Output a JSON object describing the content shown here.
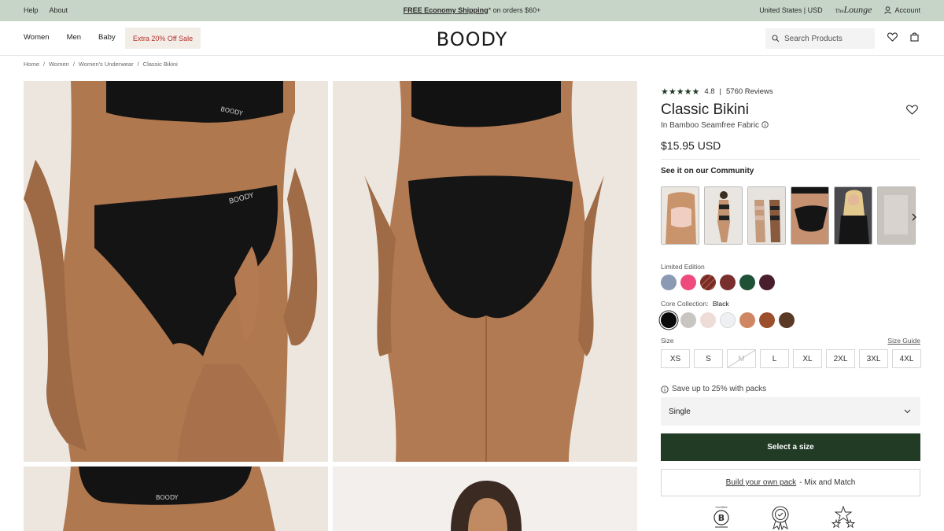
{
  "topbar": {
    "help": "Help",
    "about": "About",
    "promo_bold": "FREE Economy Shipping",
    "promo_rest": "* on orders $60+",
    "region": "United States | USD",
    "lounge_prefix": "The",
    "lounge": "Lounge",
    "account": "Account"
  },
  "header": {
    "nav": [
      "Women",
      "Men",
      "Baby"
    ],
    "sale": "Extra 20% Off Sale",
    "logo": "BOODY",
    "search_placeholder": "Search Products"
  },
  "breadcrumb": [
    "Home",
    "Women",
    "Women's Underwear",
    "Classic Bikini"
  ],
  "product": {
    "stars": "★★★★★",
    "rating": "4.8",
    "separator": "|",
    "reviews": "5760 Reviews",
    "title": "Classic Bikini",
    "fabric": "In Bamboo Seamfree Fabric",
    "price": "$15.95 USD",
    "community": "See it on our Community",
    "limited_label": "Limited Edition",
    "core_label": "Core Collection:",
    "core_selected": "Black",
    "size_label": "Size",
    "size_guide": "Size Guide",
    "sizes": [
      "XS",
      "S",
      "M",
      "L",
      "XL",
      "2XL",
      "3XL",
      "4XL"
    ],
    "unavailable_size": "M",
    "save_text": "Save up to 25% with packs",
    "pack_selected": "Single",
    "cta": "Select a size",
    "build_link": "Build your own pack",
    "build_rest": "- Mix and Match",
    "image_logo": "BOODY"
  },
  "colors": {
    "accent": "#213b25",
    "topbar": "#c7d5c8",
    "sale_text": "#b5302a",
    "limited": [
      "#8a9ab5",
      "#ef4a7e",
      "#7a2a24",
      "#7a2f2f",
      "#1f5136",
      "#4a1d2c"
    ],
    "core": [
      "#0a0a0a",
      "#c9c6c2",
      "#efdcd6",
      "#eef0f4",
      "#cf8662",
      "#9c4f2c",
      "#5a3a26"
    ]
  },
  "icons": [
    "user-icon",
    "search-icon",
    "heart-icon",
    "bag-icon",
    "info-icon",
    "chevron-right-icon",
    "chevron-down-icon",
    "b-corp-icon",
    "award-icon",
    "stars-icon"
  ]
}
